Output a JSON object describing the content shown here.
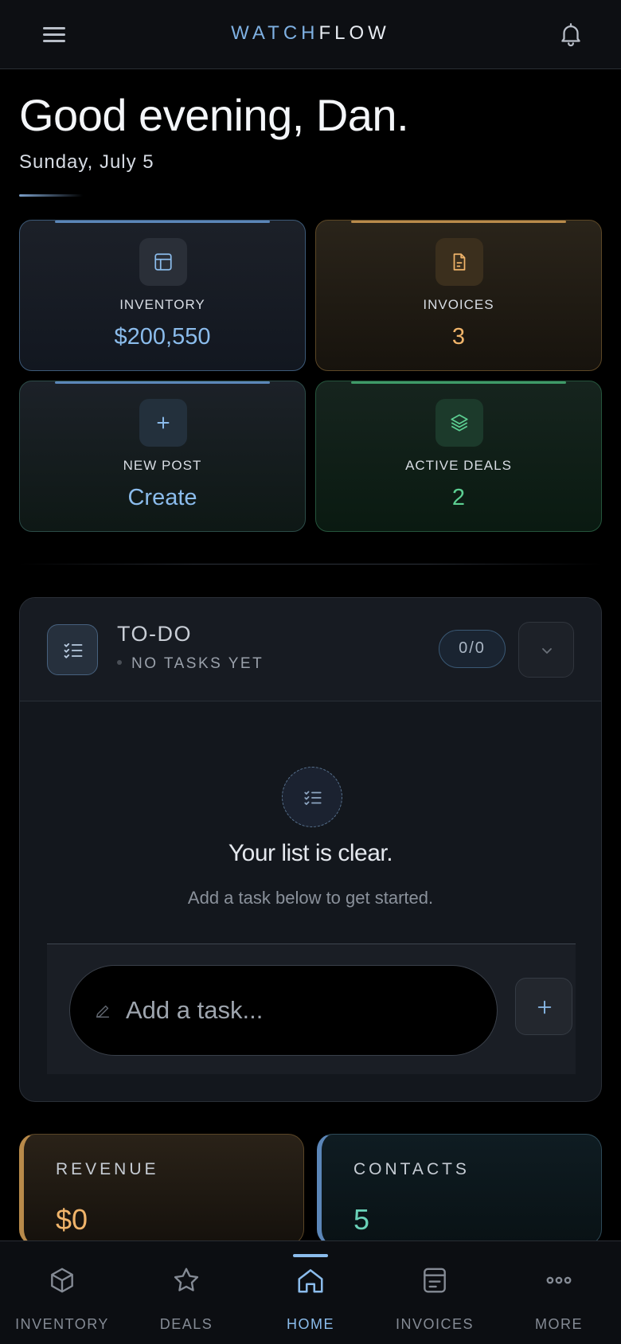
{
  "header": {
    "brand_part1": "WATCH",
    "brand_part2": "FLOW",
    "menu_icon": "hamburger-icon",
    "notification_icon": "bell-icon"
  },
  "greeting": {
    "title": "Good evening, Dan.",
    "date": "Sunday, July 5"
  },
  "stats": [
    {
      "label": "INVENTORY",
      "value": "$200,550",
      "icon": "inventory-icon",
      "accent": "#5b86b8"
    },
    {
      "label": "INVOICES",
      "value": "3",
      "icon": "document-icon",
      "accent": "#b88a4a"
    },
    {
      "label": "NEW POST",
      "value": "Create",
      "icon": "plus-icon",
      "accent": "#5b86b8"
    },
    {
      "label": "ACTIVE DEALS",
      "value": "2",
      "icon": "layers-icon",
      "accent": "#3f9a68"
    }
  ],
  "todo": {
    "title": "TO-DO",
    "subtitle": "NO TASKS YET",
    "count": "0/0",
    "empty_title": "Your list is clear.",
    "empty_subtitle": "Add a task below to get started.",
    "input_placeholder": "Add a task..."
  },
  "summary": {
    "revenue_label": "REVENUE",
    "revenue_value": "$0",
    "contacts_label": "CONTACTS",
    "contacts_value": "5"
  },
  "nav": [
    {
      "label": "INVENTORY",
      "icon": "cube-icon",
      "active": false
    },
    {
      "label": "DEALS",
      "icon": "star-icon",
      "active": false
    },
    {
      "label": "HOME",
      "icon": "home-icon",
      "active": true
    },
    {
      "label": "INVOICES",
      "icon": "invoice-icon",
      "active": false
    },
    {
      "label": "MORE",
      "icon": "more-icon",
      "active": false
    }
  ],
  "colors": {
    "accent_blue": "#8bbcec",
    "accent_gold": "#f0b46a",
    "accent_green": "#5ccf92",
    "accent_teal": "#6ad1b8"
  }
}
